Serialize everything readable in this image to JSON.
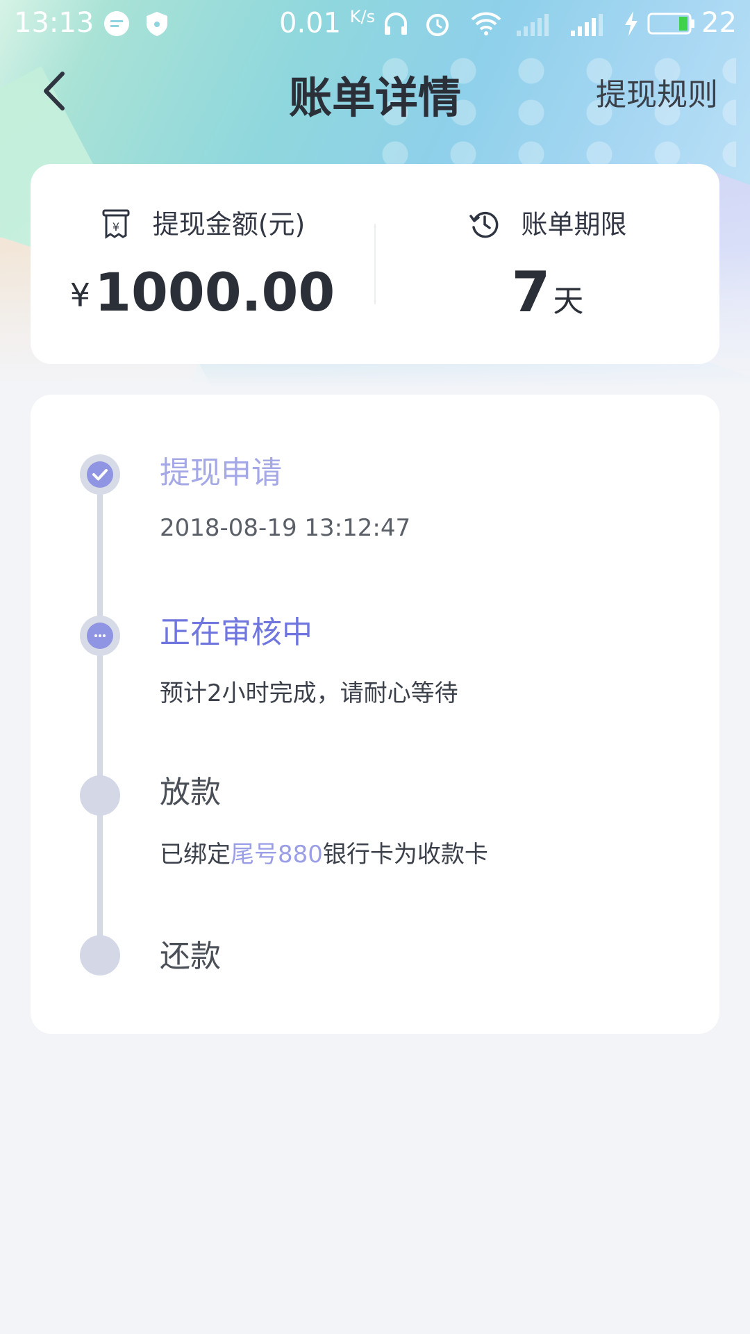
{
  "status_bar": {
    "time": "13:13",
    "speed_value": "0.01",
    "speed_unit": "K/s",
    "battery": "22"
  },
  "nav": {
    "title": "账单详情",
    "rules_link": "提现规则"
  },
  "summary": {
    "amount_label": "提现金额(元)",
    "currency_symbol": "¥",
    "amount": "1000.00",
    "term_label": "账单期限",
    "term_value": "7",
    "term_unit": "天"
  },
  "timeline": {
    "steps": [
      {
        "title": "提现申请",
        "subtitle": "2018-08-19 13:12:47",
        "state": "done"
      },
      {
        "title": "正在审核中",
        "subtitle": "预计2小时完成，请耐心等待",
        "state": "active"
      },
      {
        "title": "放款",
        "subtitle_prefix": "已绑定",
        "subtitle_highlight": "尾号880",
        "subtitle_suffix": "银行卡为收款卡",
        "state": "pending"
      },
      {
        "title": "还款",
        "state": "pending"
      }
    ]
  },
  "colors": {
    "accent": "#8f95e2",
    "active_text": "#6f76dd",
    "pending_node": "#d3d7e6",
    "background": "#f3f4f8"
  }
}
